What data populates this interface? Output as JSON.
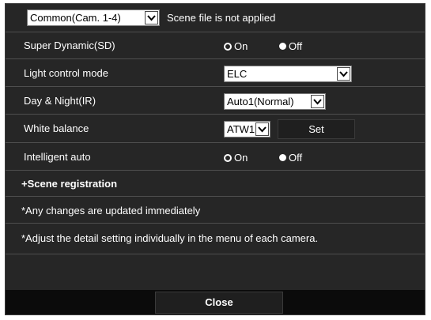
{
  "header": {
    "camera_select_value": "Common(Cam. 1-4)",
    "scene_status": "Scene file is not applied"
  },
  "rows": {
    "super_dynamic": {
      "label": "Super Dynamic(SD)",
      "on": "On",
      "off": "Off",
      "selected": "On"
    },
    "light_control": {
      "label": "Light control mode",
      "value": "ELC"
    },
    "day_night": {
      "label": "Day & Night(IR)",
      "value": "Auto1(Normal)"
    },
    "white_balance": {
      "label": "White balance",
      "value": "ATW1",
      "set_button": "Set"
    },
    "intelligent_auto": {
      "label": "Intelligent auto",
      "on": "On",
      "off": "Off",
      "selected": "On"
    }
  },
  "scene_registration": "+Scene registration",
  "notes": {
    "immediate": "*Any changes are updated immediately",
    "detail": "*Adjust the detail setting individually in the menu of each camera."
  },
  "close_button": "Close",
  "colors": {
    "panel_bg": "#262626",
    "divider": "#4e4e4e",
    "footer_bg": "#0b0b0b",
    "button_bg": "#1f1f1f"
  },
  "icons": {
    "dropdown": "chevron-down-icon",
    "radio": "radio-button-icon"
  }
}
